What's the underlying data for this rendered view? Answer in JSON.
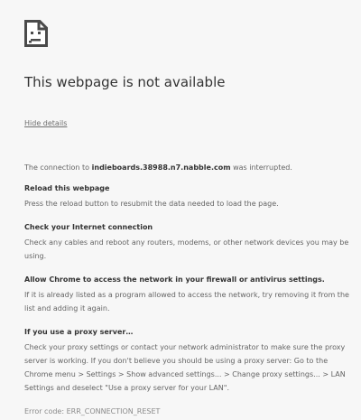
{
  "icon": {
    "name": "sad-page-icon"
  },
  "title": "This webpage is not available",
  "hide_details_label": "Hide details",
  "connection": {
    "prefix": "The connection to ",
    "host": "indieboards.38988.n7.nabble.com",
    "suffix": " was interrupted."
  },
  "sections": [
    {
      "title": "Reload this webpage",
      "body": "Press the reload button to resubmit the data needed to load the page."
    },
    {
      "title": "Check your Internet connection",
      "body": "Check any cables and reboot any routers, modems, or other network devices you may be using."
    },
    {
      "title": "Allow Chrome to access the network in your firewall or antivirus settings.",
      "body": "If it is already listed as a program allowed to access the network, try removing it from the list and adding it again."
    },
    {
      "title": "If you use a proxy server…",
      "body": "Check your proxy settings or contact your network administrator to make sure the proxy server is working. If you don't believe you should be using a proxy server: Go to the Chrome menu > Settings > Show advanced settings... > Change proxy settings... > LAN Settings and deselect \"Use a proxy server for your LAN\"."
    }
  ],
  "error_code": "Error code: ERR_CONNECTION_RESET"
}
